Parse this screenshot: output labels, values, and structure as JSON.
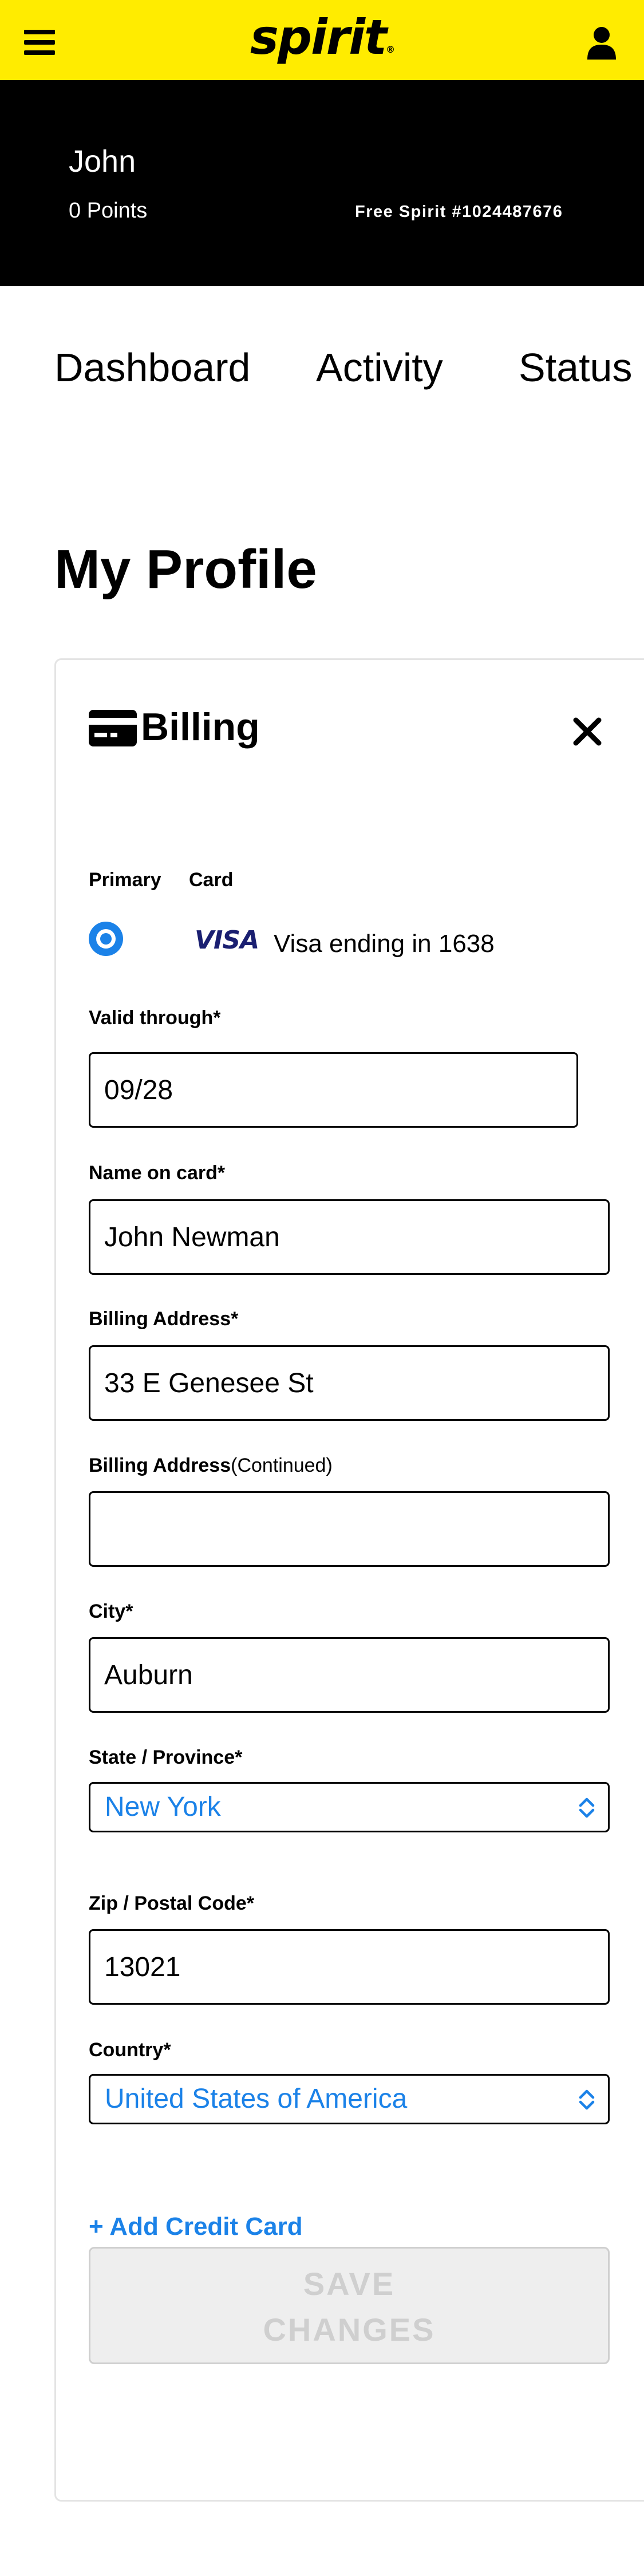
{
  "header": {
    "logo_text": "spirit",
    "logo_mark": "®",
    "menu_icon": "hamburger-menu-icon",
    "account_icon": "user-icon",
    "background_color": "#ffec00"
  },
  "member": {
    "name": "John",
    "points": "0 Points",
    "free_spirit_number": "Free Spirit #1024487676"
  },
  "tabs": [
    {
      "label": "Dashboard"
    },
    {
      "label": "Activity"
    },
    {
      "label": "Status"
    }
  ],
  "page_title": "My Profile",
  "billing": {
    "title": "Billing",
    "icon": "credit-card-icon",
    "close_icon": "close-icon",
    "columns": {
      "primary": "Primary",
      "card": "Card"
    },
    "card_entry": {
      "brand": "VISA",
      "description": "Visa ending in 1638",
      "selected": true
    },
    "fields": {
      "valid_through": {
        "label": "Valid through*",
        "value": "09/28"
      },
      "name_on_card": {
        "label": "Name on card*",
        "value": "John Newman"
      },
      "billing_address": {
        "label": "Billing Address*",
        "value": "33 E Genesee St"
      },
      "billing_address_continued": {
        "label": "Billing Address",
        "label_suffix": "(Continued)",
        "value": ""
      },
      "city": {
        "label": "City*",
        "value": "Auburn"
      },
      "state": {
        "label": "State / Province*",
        "value": "New York"
      },
      "zip": {
        "label": "Zip / Postal Code*",
        "value": "13021"
      },
      "country": {
        "label": "Country*",
        "value": "United States of America"
      }
    },
    "add_card_label": "+ Add Credit Card",
    "save_button": {
      "line1": "SAVE",
      "line2": "CHANGES",
      "disabled": true
    }
  },
  "colors": {
    "accent_blue": "#1b82e8",
    "visa_blue": "#1a1f71",
    "disabled_text": "#cfcfcf"
  }
}
